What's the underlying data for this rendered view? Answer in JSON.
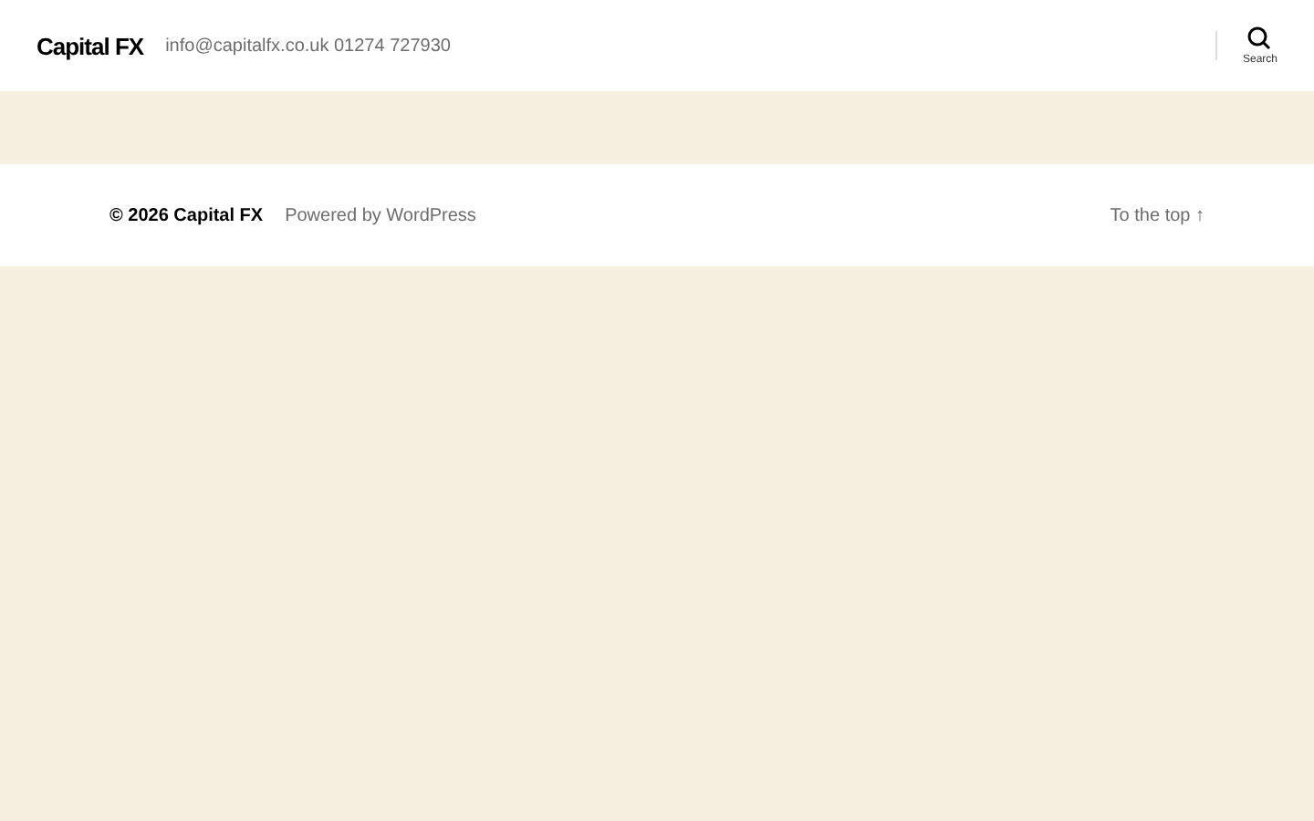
{
  "header": {
    "site_title": "Capital FX",
    "description": "info@capitalfx.co.uk 01274 727930",
    "search_label": "Search"
  },
  "footer": {
    "copyright": "© 2026 Capital FX",
    "powered_by": "Powered by WordPress",
    "to_top": "To the top ↑"
  }
}
